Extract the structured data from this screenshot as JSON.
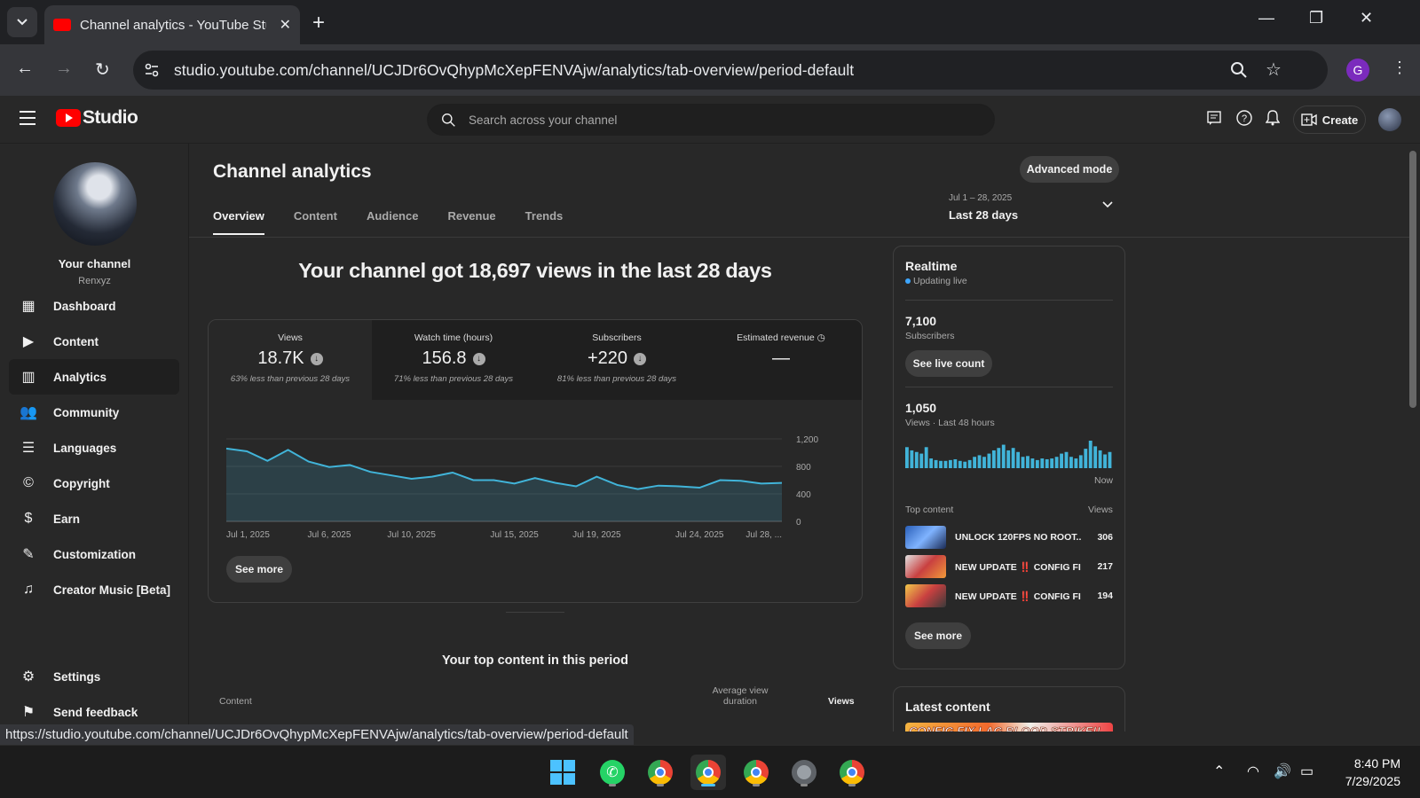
{
  "browser": {
    "tab_title": "Channel analytics - YouTube Studio",
    "url": "studio.youtube.com/channel/UCJDr6OvQhypMcXepFENVAjw/analytics/tab-overview/period-default",
    "profile_letter": "G",
    "status_url": "https://studio.youtube.com/channel/UCJDr6OvQhypMcXepFENVAjw/analytics/tab-overview/period-default"
  },
  "header": {
    "logo_text": "Studio",
    "search_placeholder": "Search across your channel",
    "create_label": "Create"
  },
  "sidebar": {
    "channel_name": "Your channel",
    "channel_handle": "Renxyz",
    "items": [
      {
        "label": "Dashboard",
        "icon": "dashboard-icon"
      },
      {
        "label": "Content",
        "icon": "content-icon"
      },
      {
        "label": "Analytics",
        "icon": "analytics-icon",
        "active": true
      },
      {
        "label": "Community",
        "icon": "community-icon"
      },
      {
        "label": "Languages",
        "icon": "languages-icon"
      },
      {
        "label": "Copyright",
        "icon": "copyright-icon"
      },
      {
        "label": "Earn",
        "icon": "earn-icon"
      },
      {
        "label": "Customization",
        "icon": "customization-icon"
      },
      {
        "label": "Creator Music [Beta]",
        "icon": "music-icon"
      }
    ],
    "settings_label": "Settings",
    "feedback_label": "Send feedback"
  },
  "main": {
    "title": "Channel analytics",
    "advanced_mode": "Advanced mode",
    "tabs": [
      "Overview",
      "Content",
      "Audience",
      "Revenue",
      "Trends"
    ],
    "active_tab": "Overview",
    "date_range": "Jul 1 – 28, 2025",
    "date_label": "Last 28 days",
    "headline": "Your channel got 18,697 views in the last 28 days",
    "metrics": [
      {
        "label": "Views",
        "value": "18.7K",
        "sub": "63% less than previous 28 days"
      },
      {
        "label": "Watch time (hours)",
        "value": "156.8",
        "sub": "71% less than previous 28 days"
      },
      {
        "label": "Subscribers",
        "value": "+220",
        "sub": "81% less than previous 28 days"
      },
      {
        "label": "Estimated revenue",
        "value": "—",
        "sub": ""
      }
    ],
    "see_more": "See more",
    "top_content_title": "Your top content in this period",
    "table_headers": {
      "content": "Content",
      "avg_view_duration": "Average view duration",
      "views": "Views"
    }
  },
  "chart_data": {
    "type": "area",
    "title": "",
    "xlabel": "",
    "ylabel": "",
    "ylim": [
      0,
      1200
    ],
    "y_ticks": [
      0,
      400,
      800,
      1200
    ],
    "x_tick_labels": [
      "Jul 1, 2025",
      "Jul 6, 2025",
      "Jul 10, 2025",
      "Jul 15, 2025",
      "Jul 19, 2025",
      "Jul 24, 2025",
      "Jul 28, ..."
    ],
    "x_tick_index": [
      0,
      5,
      9,
      14,
      18,
      23,
      27
    ],
    "series": [
      {
        "values": [
          1060,
          1020,
          880,
          1040,
          870,
          790,
          820,
          720,
          670,
          620,
          650,
          710,
          600,
          600,
          550,
          630,
          560,
          510,
          650,
          530,
          470,
          520,
          510,
          490,
          600,
          590,
          550,
          560
        ]
      }
    ],
    "grid": true
  },
  "realtime": {
    "title": "Realtime",
    "updating": "Updating live",
    "subscribers_value": "7,100",
    "subscribers_label": "Subscribers",
    "see_live_count": "See live count",
    "views_value": "1,050",
    "views_label": "Views · Last 48 hours",
    "now_label": "Now",
    "bars": [
      26,
      22,
      20,
      18,
      26,
      12,
      10,
      9,
      9,
      10,
      11,
      9,
      8,
      10,
      14,
      16,
      14,
      18,
      22,
      25,
      29,
      22,
      25,
      20,
      14,
      15,
      12,
      10,
      12,
      11,
      12,
      14,
      18,
      20,
      14,
      12,
      16,
      24,
      34,
      27,
      22,
      17,
      20
    ],
    "top_content_label": "Top content",
    "views_header": "Views",
    "top_content": [
      {
        "title": "UNLOCK 120FPS NO ROOT...",
        "views": "306"
      },
      {
        "title": "NEW UPDATE ‼️ CONFIG FI...",
        "views": "217"
      },
      {
        "title": "NEW UPDATE ‼️ CONFIG FI...",
        "views": "194"
      }
    ],
    "see_more": "See more"
  },
  "latest": {
    "title": "Latest content",
    "thumb_text": "CONFIG FIX LAG BLOOD STRIKE!!"
  },
  "taskbar": {
    "time": "8:40 PM",
    "date": "7/29/2025"
  },
  "colors": {
    "accent_blue": "#3ea6ff",
    "chart_line": "#41b4d9",
    "yt_red": "#ff0000"
  }
}
